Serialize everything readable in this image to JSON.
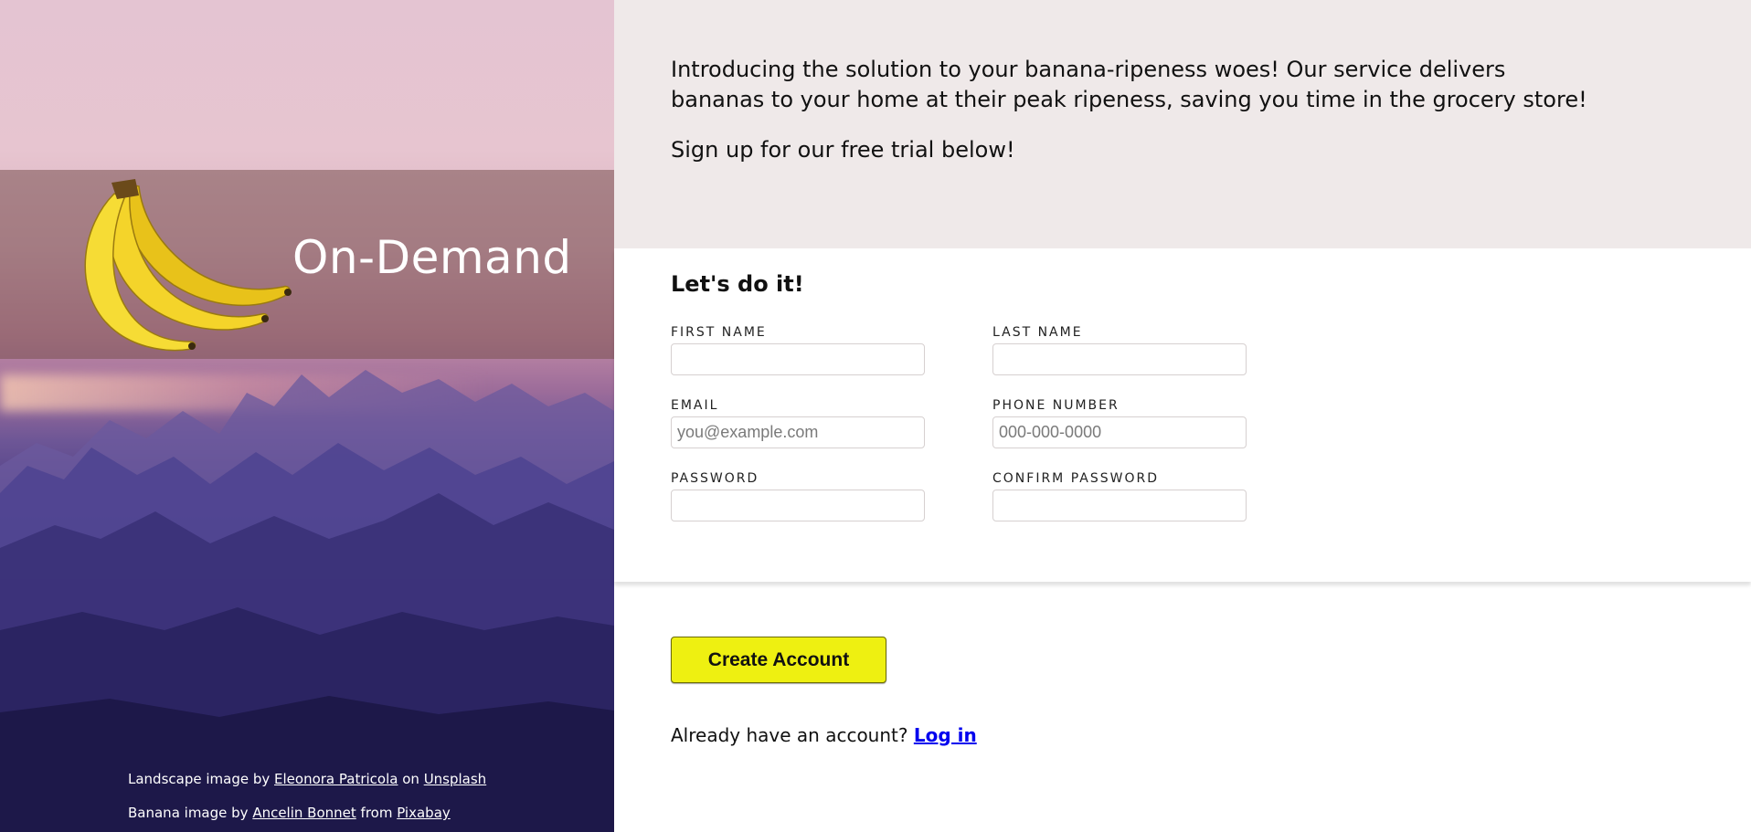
{
  "sidebar": {
    "brand_title": "On-Demand",
    "credits": {
      "landscape_prefix": "Landscape image by ",
      "landscape_author": "Eleonora Patricola",
      "landscape_middle": " on ",
      "landscape_source": "Unsplash",
      "banana_prefix": "Banana image by ",
      "banana_author": "Ancelin Bonnet",
      "banana_middle": " from ",
      "banana_source": "Pixabay"
    }
  },
  "intro": {
    "text": "Introducing the solution to your banana-ripeness woes! Our service delivers bananas to your home at their peak ripeness, saving you time in the grocery store!",
    "cta": "Sign up for our free trial below!"
  },
  "form": {
    "heading": "Let's do it!",
    "fields": {
      "first_name": {
        "label": "FIRST NAME",
        "value": "",
        "placeholder": ""
      },
      "last_name": {
        "label": "LAST NAME",
        "value": "",
        "placeholder": ""
      },
      "email": {
        "label": "EMAIL",
        "value": "",
        "placeholder": "you@example.com"
      },
      "phone": {
        "label": "PHONE NUMBER",
        "value": "",
        "placeholder": "000-000-0000"
      },
      "password": {
        "label": "PASSWORD",
        "value": "",
        "placeholder": ""
      },
      "confirm_password": {
        "label": "CONFIRM PASSWORD",
        "value": "",
        "placeholder": ""
      }
    },
    "submit_label": "Create Account",
    "login_prompt": "Already have an account? ",
    "login_link": "Log in"
  },
  "colors": {
    "accent_button": "#eef011",
    "intro_background": "#efe9e9",
    "link": "#0000ee"
  },
  "icons": {
    "brand_image": "banana-icon"
  }
}
